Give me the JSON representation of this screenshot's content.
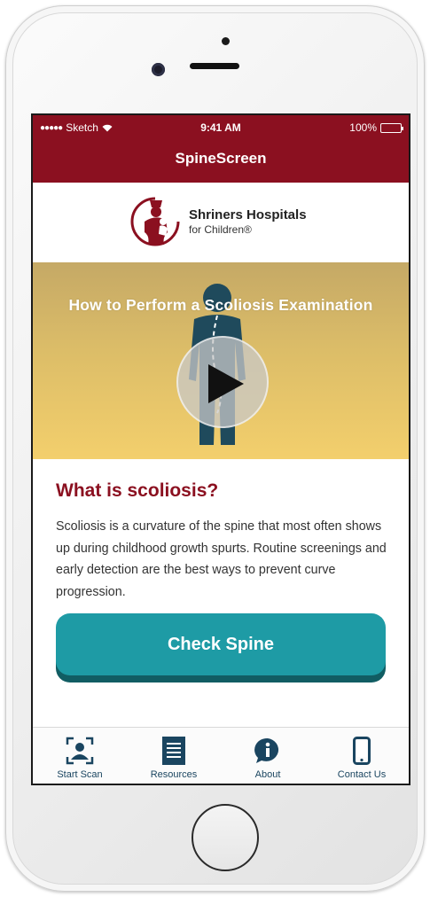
{
  "status_bar": {
    "carrier": "Sketch",
    "time": "9:41 AM",
    "battery": "100%"
  },
  "header": {
    "title": "SpineScreen"
  },
  "logo": {
    "name": "Shriners Hospitals",
    "subtitle": "for Children®"
  },
  "video": {
    "title": "How to Perform a Scoliosis Examination"
  },
  "info": {
    "heading": "What is scoliosis?",
    "body": "Scoliosis is a curvature of the spine that most often shows up during childhood growth spurts. Routine screenings and early detection are the best ways to prevent curve progression."
  },
  "cta": {
    "label": "Check Spine"
  },
  "tabs": [
    {
      "label": "Start Scan",
      "icon": "scan-person-icon"
    },
    {
      "label": "Resources",
      "icon": "document-icon"
    },
    {
      "label": "About",
      "icon": "info-bubble-icon"
    },
    {
      "label": "Contact Us",
      "icon": "phone-icon"
    }
  ],
  "colors": {
    "brand_red": "#8b1020",
    "button_teal": "#1e9ba5",
    "tab_navy": "#1a4560"
  }
}
